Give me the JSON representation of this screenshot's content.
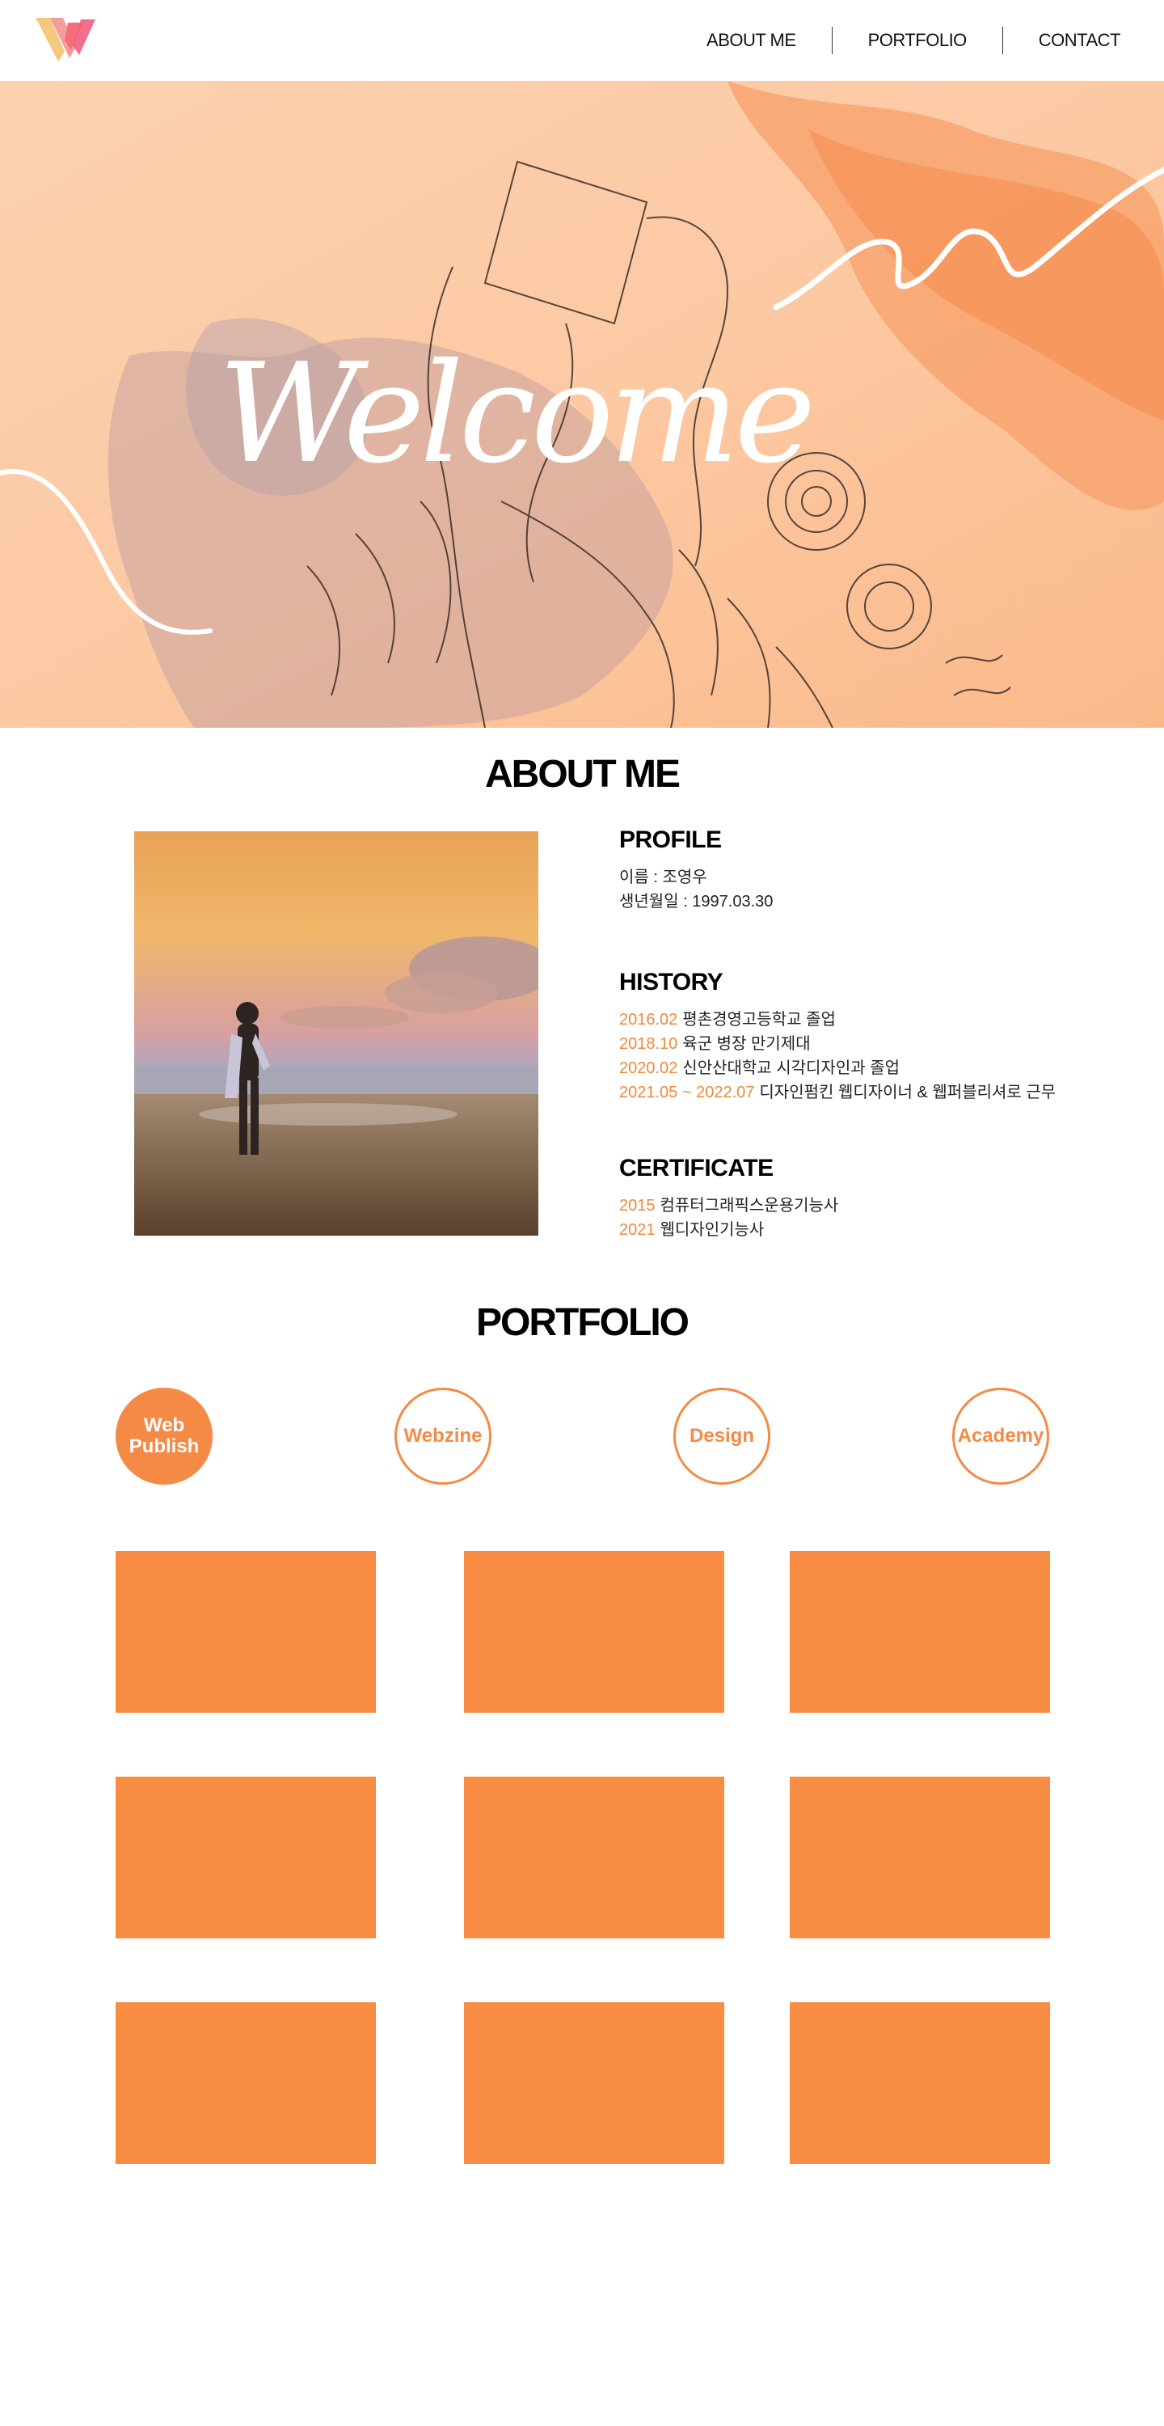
{
  "header": {
    "nav": [
      "ABOUT ME",
      "PORTFOLIO",
      "CONTACT"
    ]
  },
  "hero": {
    "headline": "Welcome"
  },
  "about": {
    "title": "ABOUT ME",
    "profile": {
      "heading": "PROFILE",
      "lines": [
        "이름 : 조영우",
        "생년월일 : 1997.03.30"
      ]
    },
    "history": {
      "heading": "HISTORY",
      "items": [
        {
          "date": "2016.02",
          "text": "평촌경영고등학교 졸업"
        },
        {
          "date": "2018.10",
          "text": "육군 병장 만기제대"
        },
        {
          "date": "2020.02",
          "text": "신안산대학교 시각디자인과 졸업"
        },
        {
          "date": "2021.05 ~ 2022.07",
          "text": "디자인펌킨 웹디자이너 & 웹퍼블리셔로 근무"
        }
      ]
    },
    "certificate": {
      "heading": "CERTIFICATE",
      "items": [
        {
          "date": "2015",
          "text": "컴퓨터그래픽스운용기능사"
        },
        {
          "date": "2021",
          "text": "웹디자인기능사"
        }
      ]
    }
  },
  "portfolio": {
    "title": "PORTFOLIO",
    "filters": [
      {
        "label_line1": "Web",
        "label_line2": "Publish",
        "active": true
      },
      {
        "label_line1": "Webzine",
        "label_line2": "",
        "active": false
      },
      {
        "label_line1": "Design",
        "label_line2": "",
        "active": false
      },
      {
        "label_line1": "Academy",
        "label_line2": "",
        "active": false
      }
    ],
    "card_count": 9
  },
  "colors": {
    "accent": "#f48a45",
    "card": "#f88c42",
    "hero_bg": "#fcc39c"
  },
  "icons": [
    "logo-icon"
  ]
}
